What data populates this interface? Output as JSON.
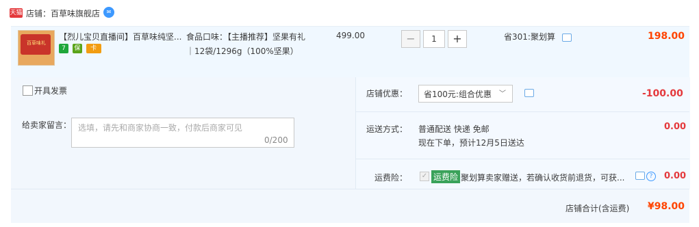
{
  "shop": {
    "logo_text": "天猫",
    "label": "店铺：百草味旗舰店",
    "contact_icon": "chat-bubble-icon"
  },
  "item": {
    "thumb_text": "百草味礼",
    "title": "【烈儿宝贝直播间】百草味纯坚...",
    "badges": [
      "7",
      "保",
      "卡"
    ],
    "sku_line1": "食品口味：【主播推荐】坚果有礼",
    "sku_line2": "｜12袋/1296g（100%坚果）",
    "unit_price": "499.00",
    "quantity": "1",
    "qty_minus": "−",
    "qty_plus": "+",
    "discount": "省301:聚划算",
    "subtotal": "198.00"
  },
  "invoice": {
    "label": "开具发票"
  },
  "message": {
    "label": "给卖家留言：",
    "placeholder": "选填，请先和商家协商一致，付款后商家可见",
    "count": "0/200"
  },
  "shop_discount": {
    "label": "店铺优惠：",
    "selected": "省100元:组合优惠",
    "value": "-100.00"
  },
  "shipping": {
    "label": "运送方式：",
    "method": "普通配送 快递 免邮",
    "eta": "现在下单，预计12月5日送达",
    "value": "0.00"
  },
  "insurance": {
    "label": "运费险：",
    "checkmark": "✓",
    "tag": "运费险",
    "text": "聚划算卖家赠送，若确认收货前退货，可获...",
    "help_glyph": "?",
    "value": "0.00"
  },
  "total": {
    "label": "店铺合计(含运费)",
    "value": "¥98.00"
  },
  "colors": {
    "price_orange": "#ff4400",
    "discount_red": "#e4393c",
    "panel_bg": "#f2f7fd",
    "insurance_green": "#3aa25a",
    "link_blue": "#3d99ff"
  }
}
